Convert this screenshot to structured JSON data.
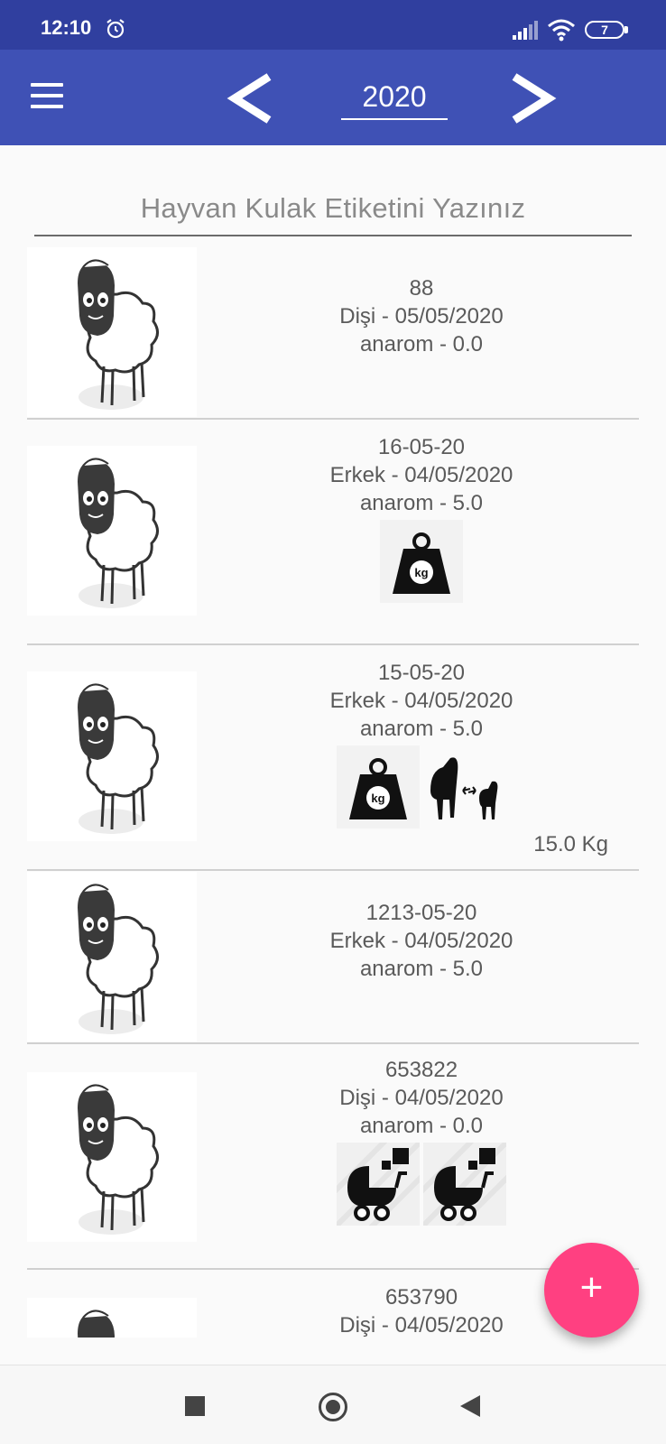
{
  "status_bar": {
    "time": "12:10",
    "battery_level": "7",
    "icons": [
      "alarm-icon",
      "signal-icon",
      "wifi-icon",
      "battery-icon"
    ]
  },
  "app_bar": {
    "menu_icon": "menu-icon",
    "prev_icon": "chevron-left-icon",
    "next_icon": "chevron-right-icon",
    "year": "2020"
  },
  "search": {
    "placeholder": "Hayvan Kulak Etiketini Yazınız",
    "value": ""
  },
  "animals": [
    {
      "tag": "88",
      "gender_date": "Dişi - 05/05/2020",
      "breed_weight": "anarom - 0.0",
      "icons": [],
      "weight_text": ""
    },
    {
      "tag": "16-05-20",
      "gender_date": "Erkek - 04/05/2020",
      "breed_weight": "anarom - 5.0",
      "icons": [
        "weight-icon"
      ],
      "weight_text": ""
    },
    {
      "tag": "15-05-20",
      "gender_date": "Erkek - 04/05/2020",
      "breed_weight": "anarom - 5.0",
      "icons": [
        "weight-icon",
        "mother-lamb-icon"
      ],
      "weight_text": "15.0 Kg"
    },
    {
      "tag": "1213-05-20",
      "gender_date": "Erkek - 04/05/2020",
      "breed_weight": "anarom - 5.0",
      "icons": [],
      "weight_text": ""
    },
    {
      "tag": "653822",
      "gender_date": "Dişi - 04/05/2020",
      "breed_weight": "anarom - 0.0",
      "icons": [
        "stroller-icon",
        "stroller-icon"
      ],
      "weight_text": ""
    },
    {
      "tag": "653790",
      "gender_date": "Dişi - 04/05/2020",
      "breed_weight": "",
      "icons": [],
      "weight_text": ""
    }
  ],
  "fab": {
    "label": "+",
    "icon": "plus-icon"
  },
  "nav_bar": {
    "icons": [
      "recents-icon",
      "home-icon",
      "back-icon"
    ]
  },
  "colors": {
    "status_bar": "#303f9f",
    "app_bar": "#3f51b5",
    "fab": "#ff4081",
    "text": "#5a5a5a"
  }
}
